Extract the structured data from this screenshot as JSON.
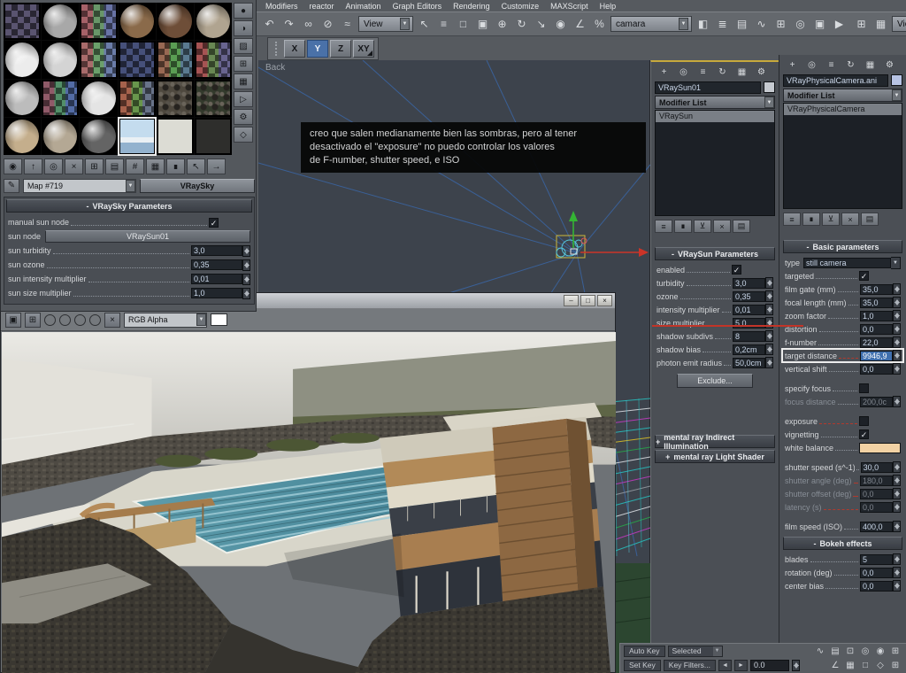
{
  "menubar": {
    "items": [
      "Modifiers",
      "reactor",
      "Animation",
      "Graph Editors",
      "Rendering",
      "Customize",
      "MAXScript",
      "Help"
    ]
  },
  "toolbar": {
    "left_icons": [
      {
        "name": "undo-icon",
        "glyph": "↶"
      },
      {
        "name": "redo-icon",
        "glyph": "↷"
      },
      {
        "name": "select-and-link-icon",
        "glyph": "∞"
      },
      {
        "name": "unlink-selection-icon",
        "glyph": "⊘"
      },
      {
        "name": "bind-to-space-warp-icon",
        "glyph": "≈"
      }
    ],
    "view_dropdown": "View",
    "mid_icons": [
      {
        "name": "select-object-icon",
        "glyph": "↖"
      },
      {
        "name": "select-by-name-icon",
        "glyph": "≡"
      },
      {
        "name": "rectangular-selection-region-icon",
        "glyph": "□"
      },
      {
        "name": "window-crossing-icon",
        "glyph": "▣"
      },
      {
        "name": "select-and-move-icon",
        "glyph": "⊕"
      },
      {
        "name": "select-and-rotate-icon",
        "glyph": "↻"
      },
      {
        "name": "select-and-scale-icon",
        "glyph": "↘"
      },
      {
        "name": "use-pivot-center-icon",
        "glyph": "◉"
      },
      {
        "name": "snap-toggle-icon",
        "glyph": "∠"
      },
      {
        "name": "percent-snap-icon",
        "glyph": "%"
      }
    ],
    "selection_set_value": "camara",
    "right_icons": [
      {
        "name": "mirror-icon",
        "glyph": "◧"
      },
      {
        "name": "align-icon",
        "glyph": "≣"
      },
      {
        "name": "layer-manager-icon",
        "glyph": "▤"
      },
      {
        "name": "curve-editor-icon",
        "glyph": "∿"
      },
      {
        "name": "schematic-view-icon",
        "glyph": "⊞"
      },
      {
        "name": "material-editor-icon",
        "glyph": "◎"
      },
      {
        "name": "render-setup-icon",
        "glyph": "▣"
      },
      {
        "name": "quick-render-icon",
        "glyph": "▶"
      }
    ],
    "far_icons": [
      {
        "name": "viewport-layout-icon",
        "glyph": "⊞"
      },
      {
        "name": "display-grid-icon",
        "glyph": "▦"
      }
    ],
    "view2_dropdown": "View",
    "end_icons": [
      {
        "name": "refresh-views-icon",
        "glyph": "↻"
      },
      {
        "name": "maximize-display-icon",
        "glyph": "▢"
      }
    ]
  },
  "axis_toolbar": {
    "buttons": [
      {
        "name": "axis-x-button",
        "label": "X"
      },
      {
        "name": "axis-y-button",
        "label": "Y",
        "kind": "active"
      },
      {
        "name": "axis-z-button",
        "label": "Z"
      },
      {
        "name": "axis-plane-xy-button",
        "label": "XY",
        "kind": "dd"
      }
    ]
  },
  "viewport": {
    "label": "Back",
    "note_lines": [
      "creo que salen medianamente bien las sombras, pero al tener",
      "desactivado el \"exposure\" no puedo controlar los valores",
      "de F-number, shutter speed, e ISO"
    ]
  },
  "material_editor": {
    "thumbnails": [
      {
        "kind": "checker",
        "color": "#5a5470"
      },
      {
        "kind": "sphere",
        "color": "#a8a8a8"
      },
      {
        "kind": "multi",
        "color": "#9a8a9a"
      },
      {
        "kind": "sphere",
        "color": "#8a6a4a"
      },
      {
        "kind": "sphere",
        "color": "#6e4e38"
      },
      {
        "kind": "sphere",
        "color": "#b0a490"
      },
      {
        "kind": "sphere",
        "color": "#ececec"
      },
      {
        "kind": "sphere",
        "color": "#d4d4d4"
      },
      {
        "kind": "multi",
        "color": "#a0a0a0"
      },
      {
        "kind": "checker",
        "color": "#46507a"
      },
      {
        "kind": "multi",
        "color": "#7a9a6a"
      },
      {
        "kind": "multi",
        "color": "#9a6a6a"
      },
      {
        "kind": "sphere",
        "color": "#bcbcbc"
      },
      {
        "kind": "multi",
        "color": "#6a7a9a"
      },
      {
        "kind": "sphere",
        "color": "#e4e4e4"
      },
      {
        "kind": "multi",
        "color": "#9a8a5a"
      },
      {
        "kind": "rock",
        "color": "#4e483e"
      },
      {
        "kind": "rock",
        "color": "#333a2c"
      },
      {
        "kind": "sphere",
        "color": "#c4ae8c"
      },
      {
        "kind": "sphere",
        "color": "#b4a894"
      },
      {
        "kind": "sphere",
        "color": "#646464"
      },
      {
        "kind": "sky sel",
        "color": "#a6c8e6"
      },
      {
        "kind": "flat",
        "color": "#dcdcd4"
      },
      {
        "kind": "flat",
        "color": "#2e2e2c"
      }
    ],
    "vertical_tools": [
      {
        "name": "sample-type-icon",
        "glyph": "●"
      },
      {
        "name": "backlight-icon",
        "glyph": "◑"
      },
      {
        "name": "sample-background-icon",
        "glyph": "▨"
      },
      {
        "name": "sample-uv-tiling-icon",
        "glyph": "⊞"
      },
      {
        "name": "video-color-check-icon",
        "glyph": "▦"
      },
      {
        "name": "make-preview-icon",
        "glyph": "▷"
      },
      {
        "name": "material-options-icon",
        "glyph": "⚙"
      },
      {
        "name": "select-by-material-icon",
        "glyph": "◇"
      }
    ],
    "horizontal_tools": [
      {
        "name": "get-material-icon",
        "glyph": "◉"
      },
      {
        "name": "put-material-to-scene-icon",
        "glyph": "↑"
      },
      {
        "name": "assign-material-to-selection-icon",
        "glyph": "◎"
      },
      {
        "name": "reset-map-icon",
        "glyph": "×"
      },
      {
        "name": "make-material-copy-icon",
        "glyph": "⊞"
      },
      {
        "name": "put-to-library-icon",
        "glyph": "▤"
      },
      {
        "name": "material-id-channel-icon",
        "glyph": "#"
      },
      {
        "name": "show-map-in-viewport-icon",
        "glyph": "▦"
      },
      {
        "name": "show-end-result-icon",
        "glyph": "∎"
      },
      {
        "name": "go-to-parent-icon",
        "glyph": "↖"
      },
      {
        "name": "go-forward-to-sibling-icon",
        "glyph": "→"
      }
    ],
    "pick_glyph": "✎",
    "map_name": "Map #719",
    "type_button_label": "VRaySky",
    "rollout_state": "-",
    "rollout_title": "VRaySky Parameters",
    "rows": [
      {
        "label": "manual sun node",
        "kind": "check on"
      },
      {
        "label": "sun node",
        "kind": "button",
        "value": "VRaySun01"
      },
      {
        "label": "sun turbidity",
        "kind": "spin",
        "value": "3,0"
      },
      {
        "label": "sun ozone",
        "kind": "spin",
        "value": "0,35"
      },
      {
        "label": "sun intensity multiplier",
        "kind": "spin",
        "value": "0,01"
      },
      {
        "label": "sun size multiplier",
        "kind": "spin",
        "value": "1,0"
      }
    ]
  },
  "render_window": {
    "controls": [
      {
        "name": "minimize-button",
        "glyph": "–"
      },
      {
        "name": "maximize-button",
        "glyph": "□"
      },
      {
        "name": "close-button",
        "glyph": "×"
      }
    ],
    "tools": [
      {
        "name": "save-image-icon",
        "glyph": "▣"
      },
      {
        "name": "clone-window-icon",
        "glyph": "⊞"
      }
    ],
    "channels": [
      {
        "name": "red-channel-icon",
        "color": "#c23a30"
      },
      {
        "name": "green-channel-icon",
        "color": "#3fa03a"
      },
      {
        "name": "blue-channel-icon",
        "color": "#3a5ec2"
      },
      {
        "name": "monochrome-channel-icon",
        "color": "#dcdcdc"
      }
    ],
    "clear_glyph": "×",
    "channel_dropdown": "RGB Alpha",
    "swatch_color": "#ffffff"
  },
  "panel_tabs": [
    {
      "name": "create-tab-icon",
      "glyph": "+"
    },
    {
      "name": "modify-tab-icon",
      "glyph": "◎"
    },
    {
      "name": "hierarchy-tab-icon",
      "glyph": "≡"
    },
    {
      "name": "motion-tab-icon",
      "glyph": "↻"
    },
    {
      "name": "display-tab-icon",
      "glyph": "▦"
    },
    {
      "name": "utilities-tab-icon",
      "glyph": "⚙"
    }
  ],
  "stack_buttons": [
    {
      "name": "pin-stack-icon",
      "glyph": "≡"
    },
    {
      "name": "show-end-result-icon",
      "glyph": "∎"
    },
    {
      "name": "make-unique-icon",
      "glyph": "⊻"
    },
    {
      "name": "remove-modifier-icon",
      "glyph": "×"
    },
    {
      "name": "configure-modifier-sets-icon",
      "glyph": "▤"
    }
  ],
  "sun_panel": {
    "object_name": "VRaySun01",
    "chip_color": "#c6cad0",
    "modifier_list_label": "Modifier List",
    "stack_items": [
      "VRaySun"
    ],
    "params_state": "-",
    "params_title": "VRaySun Parameters",
    "rows": [
      {
        "label": "enabled",
        "kind": "check on"
      },
      {
        "label": "turbidity",
        "kind": "spin",
        "value": "3,0"
      },
      {
        "label": "ozone",
        "kind": "spin",
        "value": "0,35"
      },
      {
        "label": "intensity multiplier",
        "kind": "spin",
        "value": "0,01"
      },
      {
        "label": "size multiplier",
        "kind": "spin",
        "value": "5,0"
      },
      {
        "label": "shadow subdivs",
        "kind": "spin",
        "value": "8"
      },
      {
        "label": "shadow bias",
        "kind": "spin",
        "value": "0,2cm"
      },
      {
        "label": "photon emit radius",
        "kind": "spin",
        "value": "50,0cm"
      }
    ],
    "exclude_button": "Exclude...",
    "extra_rollouts": [
      {
        "state": "+",
        "title": "mental ray Indirect Illumination"
      },
      {
        "state": "+",
        "title": "mental ray Light Shader"
      }
    ]
  },
  "cam_panel": {
    "object_name": "VRayPhysicalCamera.ani",
    "chip_color": "#b7c3e4",
    "modifier_list_label": "Modifier List",
    "stack_items": [
      "VRayPhysicalCamera"
    ],
    "basic_state": "-",
    "basic_title": "Basic parameters",
    "basic_rows": [
      {
        "label": "type",
        "kind": "dropdown",
        "value": "still camera"
      },
      {
        "label": "targeted",
        "kind": "check on"
      },
      {
        "label": "film gate (mm)",
        "kind": "spin",
        "value": "35,0"
      },
      {
        "label": "focal length (mm)",
        "kind": "spin",
        "value": "35,0"
      },
      {
        "label": "zoom factor",
        "kind": "spin",
        "value": "1,0"
      },
      {
        "label": "distortion",
        "kind": "spin",
        "value": "0,0"
      },
      {
        "label": "f-number",
        "kind": "spin",
        "value": "22,0"
      },
      {
        "label": "target distance",
        "kind": "spin sel red",
        "value": "9946,9"
      },
      {
        "label": "vertical shift",
        "kind": "spin",
        "value": "0,0"
      },
      {
        "kind": "spacer"
      },
      {
        "label": "specify focus",
        "kind": "check off"
      },
      {
        "label": "focus distance",
        "kind": "spin dis",
        "value": "200,0c"
      },
      {
        "kind": "spacer"
      },
      {
        "label": "exposure",
        "kind": "check off red"
      },
      {
        "label": "vignetting",
        "kind": "check on"
      },
      {
        "label": "white balance",
        "kind": "swatch",
        "color": "#f2d2a4"
      },
      {
        "kind": "spacer"
      },
      {
        "label": "shutter speed (s^-1)",
        "kind": "spin",
        "value": "30,0"
      },
      {
        "label": "shutter angle (deg)",
        "kind": "spin dis red",
        "value": "180,0"
      },
      {
        "label": "shutter offset (deg)",
        "kind": "spin dis red",
        "value": "0,0"
      },
      {
        "label": "latency (s)",
        "kind": "spin dis red",
        "value": "0,0"
      },
      {
        "kind": "spacer"
      },
      {
        "label": "film speed (ISO)",
        "kind": "spin",
        "value": "400,0"
      }
    ],
    "bokeh_state": "-",
    "bokeh_title": "Bokeh effects",
    "bokeh_rows": [
      {
        "label": "blades",
        "kind": "spin",
        "value": "5"
      },
      {
        "label": "rotation (deg)",
        "kind": "spin",
        "value": "0,0"
      },
      {
        "label": "center bias",
        "kind": "spin",
        "value": "0,0"
      }
    ]
  },
  "statusbar": {
    "auto_key": "Auto Key",
    "selected_dropdown": "Selected",
    "set_key": "Set Key",
    "key_filters": "Key Filters...",
    "prev_key_glyph": "◄",
    "next_key_glyph": "►",
    "time_value": "0.0",
    "row1_icons": [
      {
        "name": "mini-curve-editor-icon",
        "glyph": "∿"
      },
      {
        "name": "track-bar-icon",
        "glyph": "▤"
      },
      {
        "name": "absolute-mode-icon",
        "glyph": "⊡"
      },
      {
        "name": "pan-viewport-icon",
        "glyph": "◎"
      },
      {
        "name": "zoom-icon",
        "glyph": "◉"
      },
      {
        "name": "zoom-region-icon",
        "glyph": "⊞"
      }
    ],
    "row2_icons": [
      {
        "name": "angle-snap-icon",
        "glyph": "∠"
      },
      {
        "name": "zoom-all-icon",
        "glyph": "▦"
      },
      {
        "name": "zoom-extents-icon",
        "glyph": "□"
      },
      {
        "name": "field-of-view-icon",
        "glyph": "◇"
      },
      {
        "name": "maximize-viewport-toggle-icon",
        "glyph": "⊞"
      }
    ]
  }
}
